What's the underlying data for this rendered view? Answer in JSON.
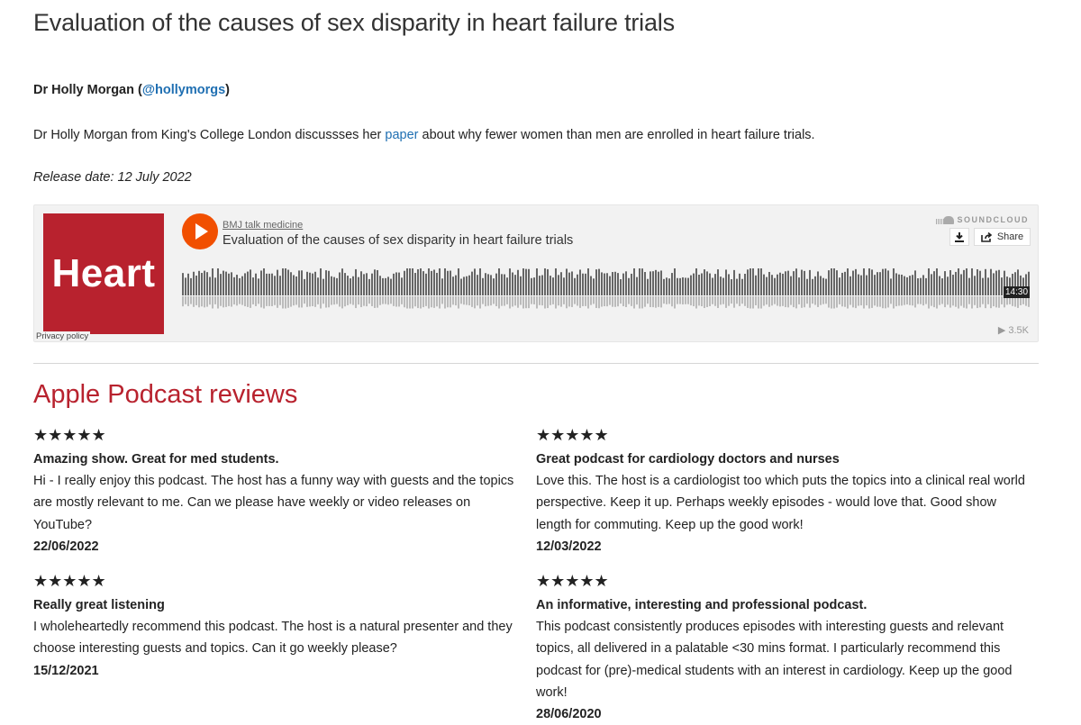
{
  "header": {
    "title": "Evaluation of the causes of sex disparity in heart failure trials",
    "author_name": "Dr Holly Morgan (",
    "author_handle": "@hollymorgs",
    "author_close": ")",
    "desc_before": "Dr Holly Morgan from King's College London discussses her ",
    "desc_link": "paper",
    "desc_after": " about why fewer women than men are enrolled in heart failure trials.",
    "release": "Release date: 12 July 2022"
  },
  "player": {
    "artwork_text": "Heart",
    "artwork_color": "#b8222e",
    "privacy": "Privacy policy",
    "uploader": "BMJ talk medicine",
    "track": "Evaluation of the causes of sex disparity in heart failure trials",
    "brand": "SOUNDCLOUD",
    "share": "Share",
    "duration": "14:30",
    "plays": "3.5K",
    "accent": "#f14f00"
  },
  "reviews_section": {
    "title": "Apple Podcast reviews",
    "stars": "★★★★★",
    "reviews": [
      {
        "title": "Amazing show. Great for med students.",
        "body": "Hi - I really enjoy this podcast. The host has a funny way with guests and the topics are mostly relevant to me. Can we please have weekly or video releases on YouTube?",
        "date": "22/06/2022"
      },
      {
        "title": "Great podcast for cardiology doctors and nurses",
        "body": "Love this. The host is a cardiologist too which puts the topics into a clinical real world perspective. Keep it up. Perhaps weekly episodes - would love that. Good show length for commuting. Keep up the good work!",
        "date": "12/03/2022"
      },
      {
        "title": "Really great listening",
        "body": "I wholeheartedly recommend this podcast. The host is a natural presenter and they choose interesting guests and topics. Can it go weekly please?",
        "date": "15/12/2021"
      },
      {
        "title": "An informative, interesting and professional podcast.",
        "body": "This podcast consistently produces episodes with interesting guests and relevant topics, all delivered in a palatable <30 mins format. I particularly recommend this podcast for (pre)-medical students with an interest in cardiology. Keep up the good work!",
        "date": "28/06/2020"
      }
    ]
  }
}
